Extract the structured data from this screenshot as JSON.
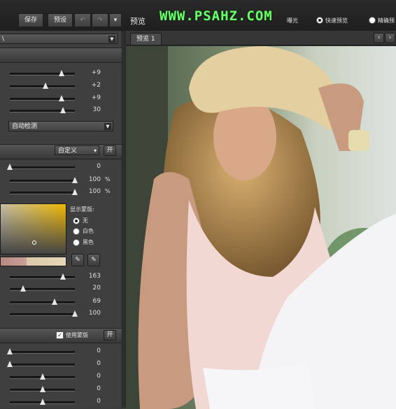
{
  "toolbar": {
    "save_label": "保存",
    "preset_label": "预设",
    "undo_icon": "undo-icon",
    "redo_icon": "redo-icon",
    "menu_icon": "chevron-down-icon"
  },
  "preview_header": {
    "title": "预览",
    "watermark": "WWW.PSAHZ.COM",
    "partial_label": "曝光",
    "fast_preview_label": "快速预览",
    "precise_preview_label": "精确预",
    "tab_label": "预览 1"
  },
  "panel1": {
    "sliders": [
      {
        "value": "+9",
        "level": 0.8
      },
      {
        "value": "+2",
        "level": 0.55
      },
      {
        "value": "+9",
        "level": 0.8
      },
      {
        "value": "30",
        "level": 0.82
      }
    ],
    "auto_detect_label": "自动检测"
  },
  "panel2": {
    "mode_label": "自定义",
    "toggle_label": "开",
    "sliders": [
      {
        "value": "0",
        "unit": "",
        "level": 0.0
      },
      {
        "value": "100",
        "unit": "%",
        "level": 1.0
      },
      {
        "value": "100",
        "unit": "%",
        "level": 1.0
      }
    ],
    "show_mask_label": "显示蒙版:",
    "mask_options": [
      {
        "label": "无",
        "selected": true
      },
      {
        "label": "白色",
        "selected": false
      },
      {
        "label": "黑色",
        "selected": false
      }
    ],
    "tone_sliders": [
      {
        "value": "163",
        "level": 0.82
      },
      {
        "value": "20",
        "level": 0.2
      },
      {
        "value": "69",
        "level": 0.69
      },
      {
        "value": "100",
        "level": 1.0
      }
    ]
  },
  "panel3": {
    "use_mask_label": "使用蒙版",
    "use_mask_checked": true,
    "toggle_label": "开",
    "sliders": [
      {
        "value": "0",
        "level": 0.0
      },
      {
        "value": "0",
        "level": 0.0
      },
      {
        "value": "0",
        "level": 0.5
      },
      {
        "value": "0",
        "level": 0.5
      },
      {
        "value": "0",
        "level": 0.5
      }
    ]
  },
  "colors": {
    "accent_yellow": "#f0b800",
    "watermark_green": "#6cff6c"
  }
}
